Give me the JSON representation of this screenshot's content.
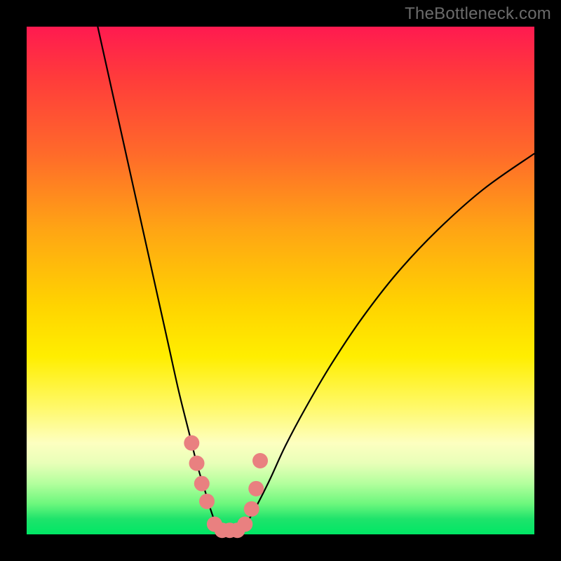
{
  "watermark": "TheBottleneck.com",
  "chart_data": {
    "type": "line",
    "title": "",
    "xlabel": "",
    "ylabel": "",
    "xlim": [
      0,
      100
    ],
    "ylim": [
      0,
      100
    ],
    "series": [
      {
        "name": "curve-left",
        "x": [
          14,
          16,
          18,
          20,
          22,
          24,
          26,
          28,
          30,
          32,
          33.5,
          35,
          36.2,
          37.2,
          38
        ],
        "y": [
          100,
          91,
          82,
          73,
          64,
          55,
          46,
          37,
          28,
          20,
          14,
          9,
          5,
          2.2,
          0.6
        ]
      },
      {
        "name": "curve-right",
        "x": [
          42,
          43.5,
          45.5,
          48,
          51,
          55,
          60,
          66,
          73,
          81,
          90,
          100
        ],
        "y": [
          0.6,
          2.5,
          6,
          11,
          17.5,
          25,
          33.5,
          42.5,
          51.5,
          60,
          68,
          75
        ]
      },
      {
        "name": "markers",
        "x": [
          32.5,
          33.5,
          34.5,
          35.5,
          37.0,
          38.5,
          40.0,
          41.5,
          43.0,
          44.3,
          45.2,
          46.0
        ],
        "y": [
          18.0,
          14.0,
          10.0,
          6.5,
          2.0,
          0.8,
          0.8,
          0.8,
          2.0,
          5.0,
          9.0,
          14.5
        ]
      }
    ],
    "marker_color": "#e98080",
    "curve_color": "#000000"
  }
}
